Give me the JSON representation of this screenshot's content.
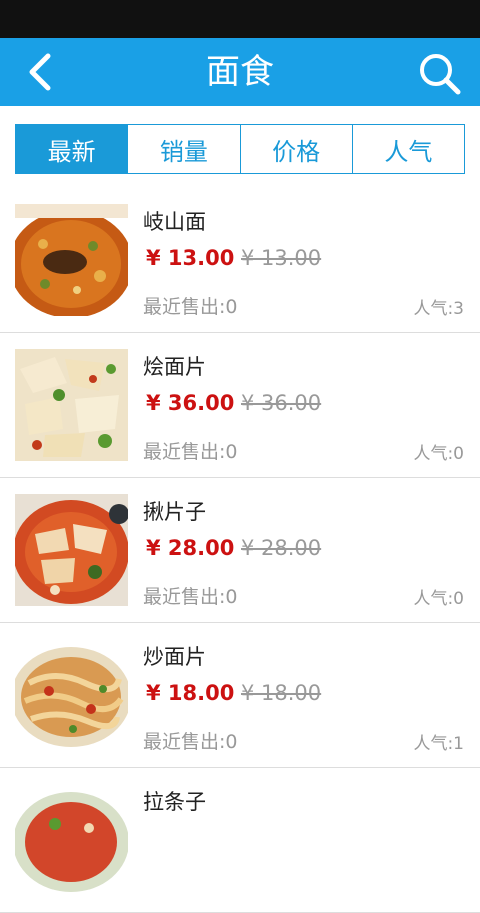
{
  "header": {
    "title": "面食"
  },
  "tabs": [
    {
      "label": "最新",
      "active": true
    },
    {
      "label": "销量",
      "active": false
    },
    {
      "label": "价格",
      "active": false
    },
    {
      "label": "人气",
      "active": false
    }
  ],
  "items": [
    {
      "name": "岐山面",
      "price": "¥ 13.00",
      "old_price": "¥ 13.00",
      "sold": "最近售出:0",
      "popularity": "人气:3"
    },
    {
      "name": "烩面片",
      "price": "¥ 36.00",
      "old_price": "¥ 36.00",
      "sold": "最近售出:0",
      "popularity": "人气:0"
    },
    {
      "name": "揪片子",
      "price": "¥ 28.00",
      "old_price": "¥ 28.00",
      "sold": "最近售出:0",
      "popularity": "人气:0"
    },
    {
      "name": "炒面片",
      "price": "¥ 18.00",
      "old_price": "¥ 18.00",
      "sold": "最近售出:0",
      "popularity": "人气:1"
    },
    {
      "name": "拉条子"
    }
  ],
  "colors": {
    "accent": "#1aa0e6",
    "price": "#cc1111",
    "muted": "#999999"
  }
}
